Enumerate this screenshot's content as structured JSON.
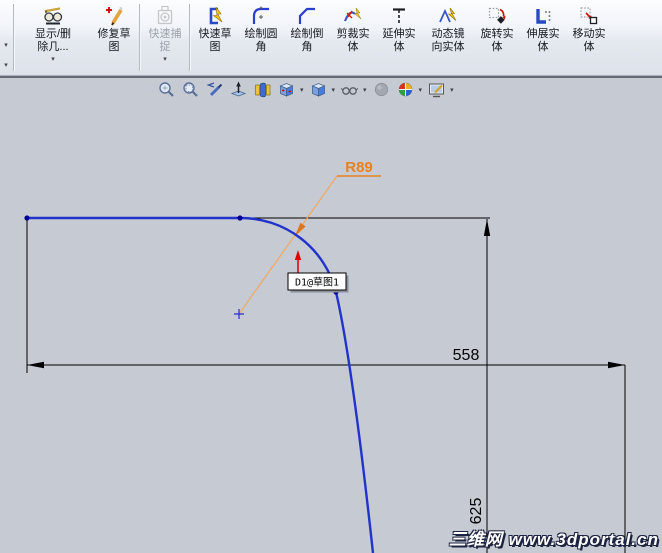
{
  "icons": {
    "caret": "▾"
  },
  "toolbar": {
    "buttons": [
      {
        "icon": "display-delete-relations-icon",
        "label_lines": [
          "显示/删",
          "除几..."
        ],
        "has_dropdown": true,
        "disabled": false
      },
      {
        "icon": "repair-sketch-icon",
        "label_lines": [
          "修复草",
          "图"
        ],
        "has_dropdown": false,
        "disabled": false
      },
      {
        "icon": "quick-snaps-icon",
        "label_lines": [
          "快速捕",
          "捉"
        ],
        "has_dropdown": true,
        "disabled": true
      },
      {
        "icon": "rapid-sketch-icon",
        "label_lines": [
          "快速草",
          "图"
        ],
        "has_dropdown": false,
        "disabled": false
      },
      {
        "icon": "sketch-fillet-icon",
        "label_lines": [
          "绘制圆",
          "角"
        ],
        "has_dropdown": false,
        "disabled": false
      },
      {
        "icon": "sketch-chamfer-icon",
        "label_lines": [
          "绘制倒",
          "角"
        ],
        "has_dropdown": false,
        "disabled": false
      },
      {
        "icon": "trim-entities-icon",
        "label_lines": [
          "剪裁实",
          "体"
        ],
        "has_dropdown": false,
        "disabled": false
      },
      {
        "icon": "extend-entities-icon",
        "label_lines": [
          "延伸实",
          "体"
        ],
        "has_dropdown": false,
        "disabled": false
      },
      {
        "icon": "dynamic-mirror-icon",
        "label_lines": [
          "动态镜",
          "向实体"
        ],
        "has_dropdown": false,
        "disabled": false
      },
      {
        "icon": "rotate-entities-icon",
        "label_lines": [
          "旋转实",
          "体"
        ],
        "has_dropdown": false,
        "disabled": false
      },
      {
        "icon": "stretch-entities-icon",
        "label_lines": [
          "伸展实",
          "体"
        ],
        "has_dropdown": false,
        "disabled": false
      },
      {
        "icon": "move-entities-icon",
        "label_lines": [
          "移动实",
          "体"
        ],
        "has_dropdown": false,
        "disabled": false
      }
    ]
  },
  "view_toolbar": {
    "icons": [
      "zoom-to-fit",
      "zoom-to-area",
      "previous-view",
      "normal-to",
      "section-view",
      "view-orientation",
      "display-style",
      "hide-show-items",
      "shadows",
      "edit-appearance",
      "apply-scene"
    ]
  },
  "sketch": {
    "dimensions": {
      "radius": "R89",
      "width": "558",
      "height": "625"
    },
    "dimension_tag": "D1@草图1",
    "colors": {
      "sketch_line": "#2233cc",
      "endpoint": "#000099",
      "dimension_orange": "#e8821e",
      "leader_orange": "#f0a860",
      "dimension_black": "#000000",
      "selection_red": "#dd0000",
      "viewport_bg": "#c6cad2"
    }
  },
  "watermark": {
    "text": "三维网 www.3dportal.cn"
  }
}
